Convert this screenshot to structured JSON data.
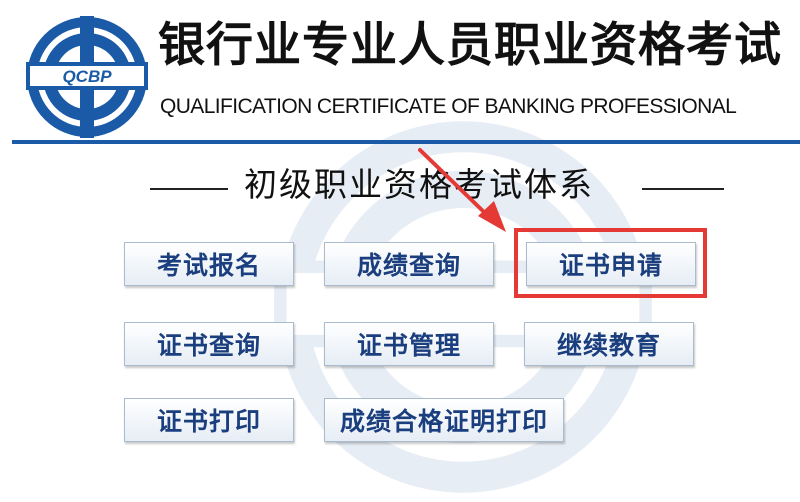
{
  "header": {
    "logo_text": "QCBP",
    "title_cn": "银行业专业人员职业资格考试",
    "title_en": "QUALIFICATION CERTIFICATE OF BANKING PROFESSIONAL"
  },
  "section": {
    "title": "初级职业资格考试体系"
  },
  "buttons": {
    "exam_registration": "考试报名",
    "score_query": "成绩查询",
    "certificate_application": "证书申请",
    "certificate_query": "证书查询",
    "certificate_management": "证书管理",
    "continuing_education": "继续教育",
    "certificate_print": "证书打印",
    "score_certificate_print": "成绩合格证明打印"
  },
  "colors": {
    "brand_blue": "#1a5aa6",
    "button_text": "#1b3f7e",
    "highlight": "#e53935"
  }
}
